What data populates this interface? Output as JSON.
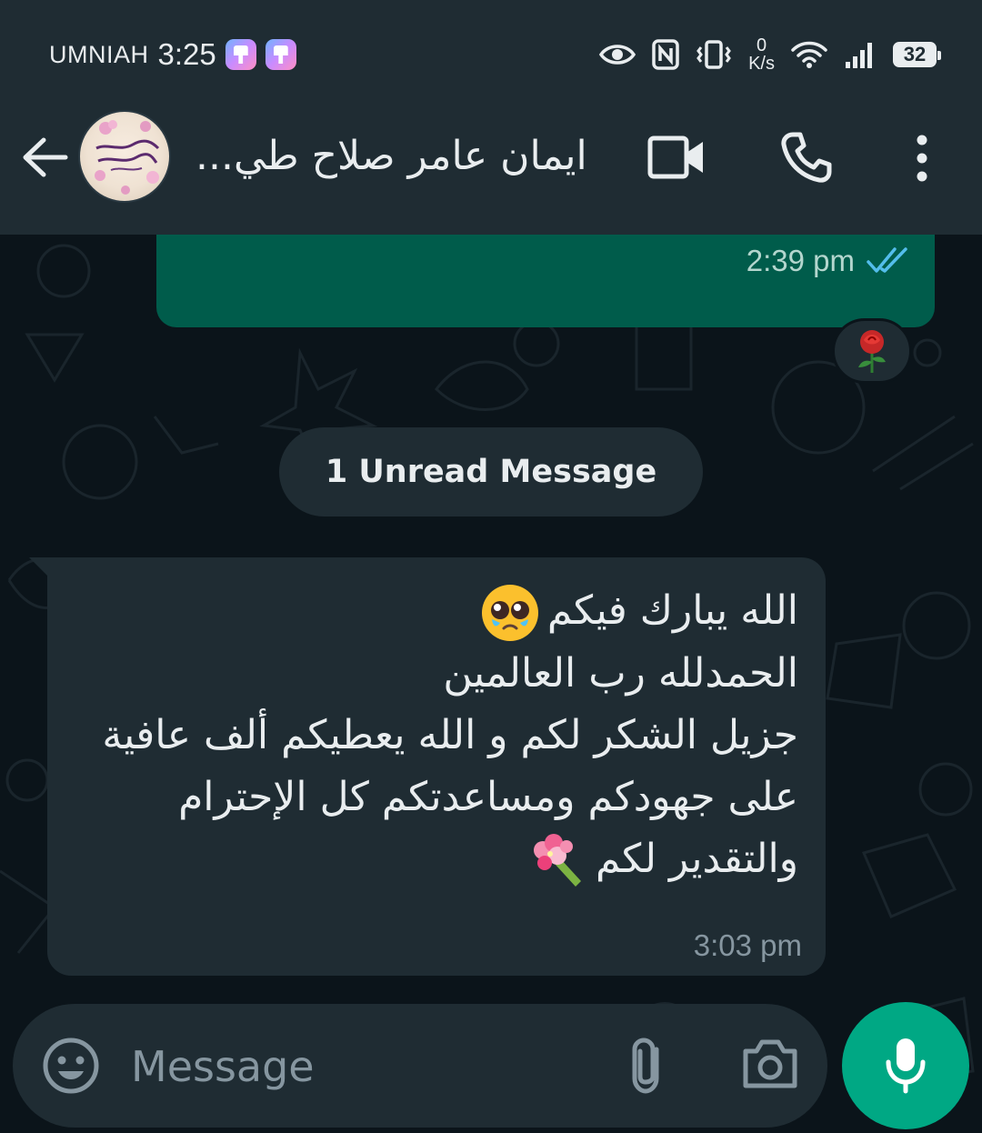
{
  "status_bar": {
    "carrier": "UMNIAH",
    "time": "3:25",
    "net_speed_value": "0",
    "net_speed_unit": "K/s",
    "battery": "32"
  },
  "header": {
    "contact_name": "ايمان عامر صلاح طي...",
    "icons": [
      "back-arrow-icon",
      "avatar",
      "video-call-icon",
      "voice-call-icon",
      "more-options-icon"
    ]
  },
  "chat": {
    "outgoing_message": {
      "time": "2:39 pm",
      "status": "read",
      "reaction": "🌹"
    },
    "unread_separator": "1 Unread Message",
    "incoming_message": {
      "lines": [
        "الله يبارك فيكم",
        "الحمدلله رب العالمين",
        "جزيل الشكر لكم و الله يعطيكم ألف عافية",
        "على جهودكم ومساعدتكم كل الإحترام",
        "والتقدير لكم"
      ],
      "line1_emoji": "🥹",
      "line5_emoji": "💐",
      "time": "3:03 pm"
    }
  },
  "composer": {
    "placeholder": "Message",
    "icons": [
      "emoji-icon",
      "attach-icon",
      "camera-icon",
      "mic-icon"
    ]
  },
  "colors": {
    "header_bg": "#1f2c33",
    "chat_bg": "#0b141a",
    "outgoing_bubble": "#005c4b",
    "incoming_bubble": "#1f2c33",
    "accent": "#00a884",
    "read_ticks": "#53bdeb"
  }
}
